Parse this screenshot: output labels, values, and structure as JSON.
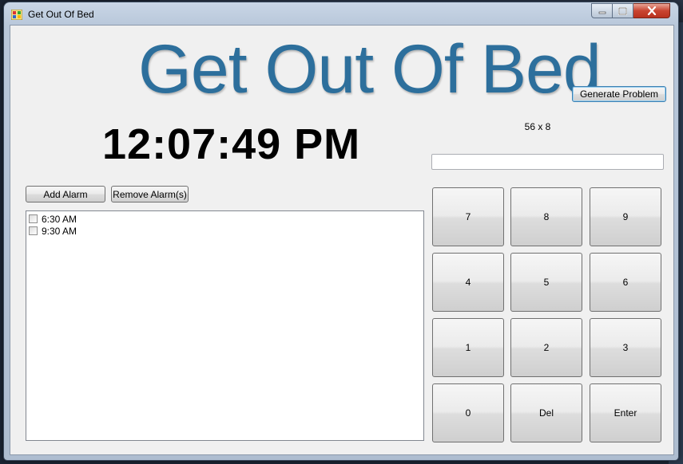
{
  "window": {
    "title": "Get Out Of Bed"
  },
  "header": {
    "app_title": "Get Out Of Bed"
  },
  "clock": {
    "time": "12:07:49 PM"
  },
  "problem": {
    "generate_label": "Generate Problem",
    "text": "56 x 8",
    "answer_value": ""
  },
  "alarms": {
    "add_label": "Add Alarm",
    "remove_label": "Remove Alarm(s)",
    "items": [
      {
        "label": "6:30 AM",
        "checked": false
      },
      {
        "label": "9:30 AM",
        "checked": false
      }
    ]
  },
  "keypad": {
    "keys": [
      "7",
      "8",
      "9",
      "4",
      "5",
      "6",
      "1",
      "2",
      "3",
      "0",
      "Del",
      "Enter"
    ]
  },
  "colors": {
    "title_blue": "#2d6f9c",
    "close_red": "#c94431"
  }
}
